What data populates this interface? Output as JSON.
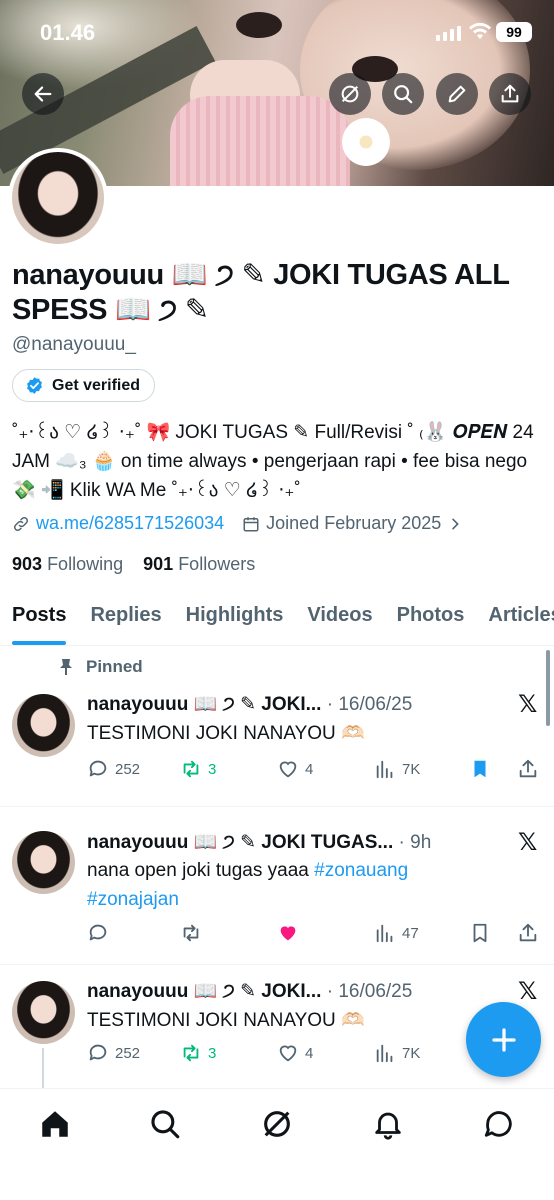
{
  "status_bar": {
    "time": "01.46",
    "battery": "99"
  },
  "header": {
    "back_icon": "arrow-left-icon",
    "grok_icon": "grok-icon",
    "search_icon": "search-icon",
    "edit_icon": "pencil-icon",
    "share_icon": "share-icon"
  },
  "profile": {
    "name": "nanayouuu 📖 ੭ ✎ JOKI TUGAS ALL SPESS 📖 ੭ ✎",
    "handle": "@nanayouuu_",
    "get_verified": "Get verified",
    "bio": "˚₊‧꒰ა ♡ ໒꒱ ‧₊˚ 🎀 JOKI TUGAS ✎ Full/Revisi ˚ ₍🐰 𝑶𝑷𝑬𝑵 24 JAM ☁️₃ 🧁 on time always • pengerjaan rapi • fee bisa nego 💸 📲 Klik WA Me ˚₊‧꒰ა ♡ ໒꒱ ‧₊˚",
    "link": "wa.me/6285171526034",
    "joined": "Joined February 2025",
    "following_count": "903",
    "following_label": "Following",
    "followers_count": "901",
    "followers_label": "Followers"
  },
  "tabs": [
    "Posts",
    "Replies",
    "Highlights",
    "Videos",
    "Photos",
    "Articles"
  ],
  "active_tab": "Posts",
  "posts": [
    {
      "pinned_label": "Pinned",
      "author": "nanayouuu 📖 ੭ ✎ JOKI...",
      "time": "· 16/06/25",
      "text": "TESTIMONI JOKI NANAYOU 🫶🏻",
      "replies": "252",
      "reposts": "3",
      "likes": "4",
      "views": "7K"
    },
    {
      "author": "nanayouuu 📖 ੭ ✎ JOKI TUGAS...",
      "time": "· 9h",
      "text": "nana open joki tugas yaaa",
      "tags": [
        "#zonauang",
        "#zonajajan"
      ],
      "replies": "",
      "reposts": "",
      "likes": "",
      "views": "47"
    },
    {
      "author": "nanayouuu 📖 ੭ ✎ JOKI...",
      "time": "· 16/06/25",
      "text": "TESTIMONI JOKI NANAYOU 🫶🏻",
      "replies": "252",
      "reposts": "3",
      "likes": "4",
      "views": "7K"
    }
  ],
  "colors": {
    "accent": "#1d9bf0",
    "repost": "#00ba7c",
    "like": "#f91880",
    "muted": "#536471"
  },
  "bottom_nav": [
    "home-icon",
    "search-icon",
    "grok-icon",
    "bell-icon",
    "message-icon"
  ]
}
